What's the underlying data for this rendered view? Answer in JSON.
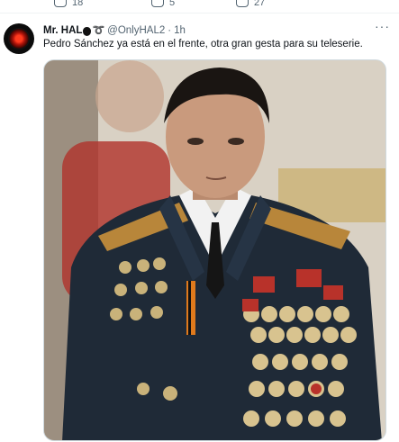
{
  "top_actions": [
    "18",
    "5",
    "27"
  ],
  "tweet": {
    "author_name": "Mr. HAL",
    "handle": "@OnlyHAL2",
    "separator": "·",
    "time": "1h",
    "text": "Pedro Sánchez ya está en el frente, otra gran gesta para su teleserie.",
    "more_label": "···"
  },
  "icons": {
    "avatar": "hal-9000-eye-avatar",
    "name_emojis": [
      "apple-emoji",
      "ring-emoji"
    ],
    "media": "military-uniform-portrait-image"
  },
  "colors": {
    "text_primary": "#0f1419",
    "text_secondary": "#536471",
    "border": "#cfd9de",
    "uniform": "#1f2a37"
  }
}
